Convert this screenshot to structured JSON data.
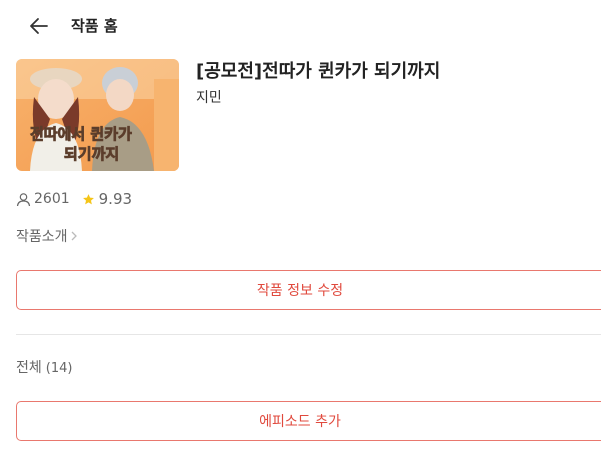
{
  "header": {
    "title": "작품 홈",
    "back_icon": "arrow-left-icon"
  },
  "work": {
    "title": "[공모전]전따가 퀸카가 되기까지",
    "author": "지민",
    "cover_text_line1": "전따에서 퀸카가",
    "cover_text_line2": "되기까지"
  },
  "stats": {
    "views": "2601",
    "rating": "9.93",
    "views_icon": "person-icon",
    "rating_icon": "star-icon"
  },
  "intro": {
    "label": "작품소개",
    "icon": "chevron-right-icon"
  },
  "buttons": {
    "edit_info": "작품 정보 수정",
    "add_episode": "에피소드 추가"
  },
  "episodes": {
    "label": "전체",
    "count": "(14)"
  },
  "colors": {
    "accent": "#e0493d",
    "star": "#f5c518",
    "cover_background": "#f6a25a"
  }
}
